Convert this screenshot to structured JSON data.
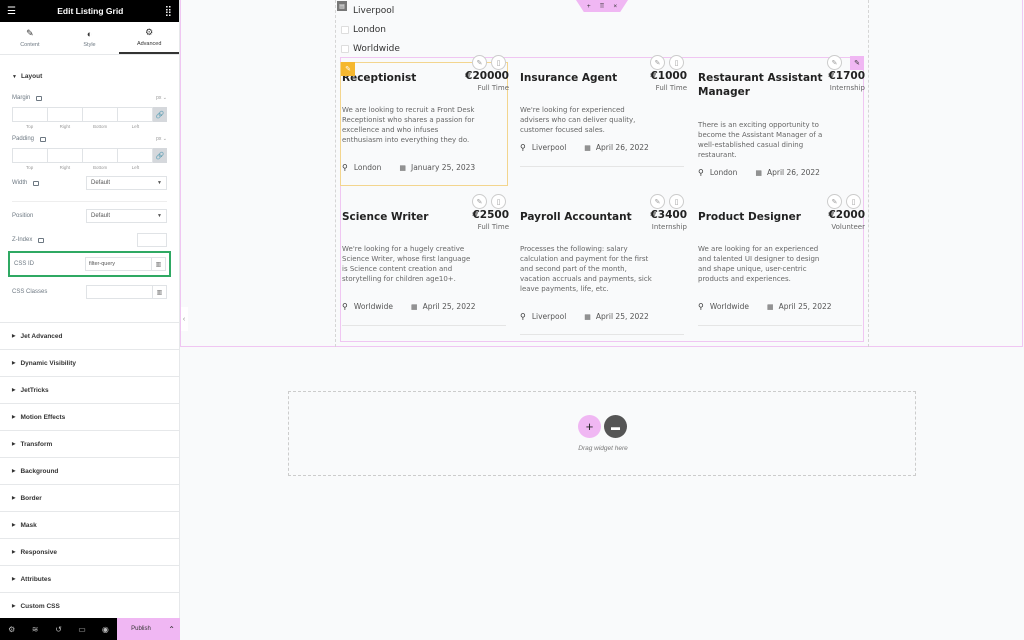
{
  "panel": {
    "title": "Edit Listing Grid",
    "tabs": [
      {
        "label": "Content",
        "icon": "pencil-icon"
      },
      {
        "label": "Style",
        "icon": "half-circle-icon"
      },
      {
        "label": "Advanced",
        "icon": "gear-icon",
        "active": true
      }
    ],
    "layout_section": "Layout",
    "margin": {
      "label": "Margin",
      "unit": "px",
      "sides": [
        "Top",
        "Right",
        "Bottom",
        "Left"
      ]
    },
    "padding": {
      "label": "Padding",
      "unit": "px",
      "sides": [
        "Top",
        "Right",
        "Bottom",
        "Left"
      ]
    },
    "width": {
      "label": "Width",
      "value": "Default"
    },
    "position": {
      "label": "Position",
      "value": "Default"
    },
    "zindex": {
      "label": "Z-Index",
      "value": ""
    },
    "css_id": {
      "label": "CSS ID",
      "value": "filter-query"
    },
    "css_classes": {
      "label": "CSS Classes",
      "value": ""
    },
    "sections": [
      "Jet Advanced",
      "Dynamic Visibility",
      "JetTricks",
      "Motion Effects",
      "Transform",
      "Background",
      "Border",
      "Mask",
      "Responsive",
      "Attributes",
      "Custom CSS"
    ],
    "footer": {
      "publish": "Publish"
    }
  },
  "colors": {
    "accent": "#f0b7f3",
    "highlight": "#2fa963",
    "selected": "#f5b72f"
  },
  "filters": [
    "Liverpool",
    "London",
    "Worldwide"
  ],
  "handle": {
    "add": "+",
    "move": "⠿",
    "close": "×"
  },
  "cards": [
    {
      "title": "Receptionist",
      "price": "€20000",
      "type": "Full Time",
      "desc": "We are looking to recruit a Front Desk Receptionist who shares a passion for excellence and who infuses enthusiasm into everything they do.",
      "location": "London",
      "date": "January 25, 2023"
    },
    {
      "title": "Insurance Agent",
      "price": "€1000",
      "type": "Full Time",
      "desc": "We're looking for experienced advisers who can deliver quality, customer focused sales.",
      "location": "Liverpool",
      "date": "April 26, 2022"
    },
    {
      "title": "Restaurant Assistant Manager",
      "price": "€1700",
      "type": "Internship",
      "desc": "There is an exciting opportunity to become the Assistant Manager of a well-established casual dining restaurant.",
      "location": "London",
      "date": "April 26, 2022"
    },
    {
      "title": "Science Writer",
      "price": "€2500",
      "type": "Full Time",
      "desc": "We're looking for a hugely creative Science Writer, whose first language is Science content creation and storytelling for children age10+.",
      "location": "Worldwide",
      "date": "April 25, 2022"
    },
    {
      "title": "Payroll Accountant",
      "price": "€3400",
      "type": "Internship",
      "desc": "Processes the following: salary calculation and payment for the first and second part of the month, vacation accruals and payments, sick leave payments, life, etc.",
      "location": "Liverpool",
      "date": "April 25, 2022"
    },
    {
      "title": "Product Designer",
      "price": "€2000",
      "type": "Volunteer",
      "desc": "We are looking for an experienced and talented UI designer to design and shape unique, user-centric products and experiences.",
      "location": "Worldwide",
      "date": "April 25, 2022"
    }
  ],
  "drop_zone": {
    "text": "Drag widget here"
  }
}
